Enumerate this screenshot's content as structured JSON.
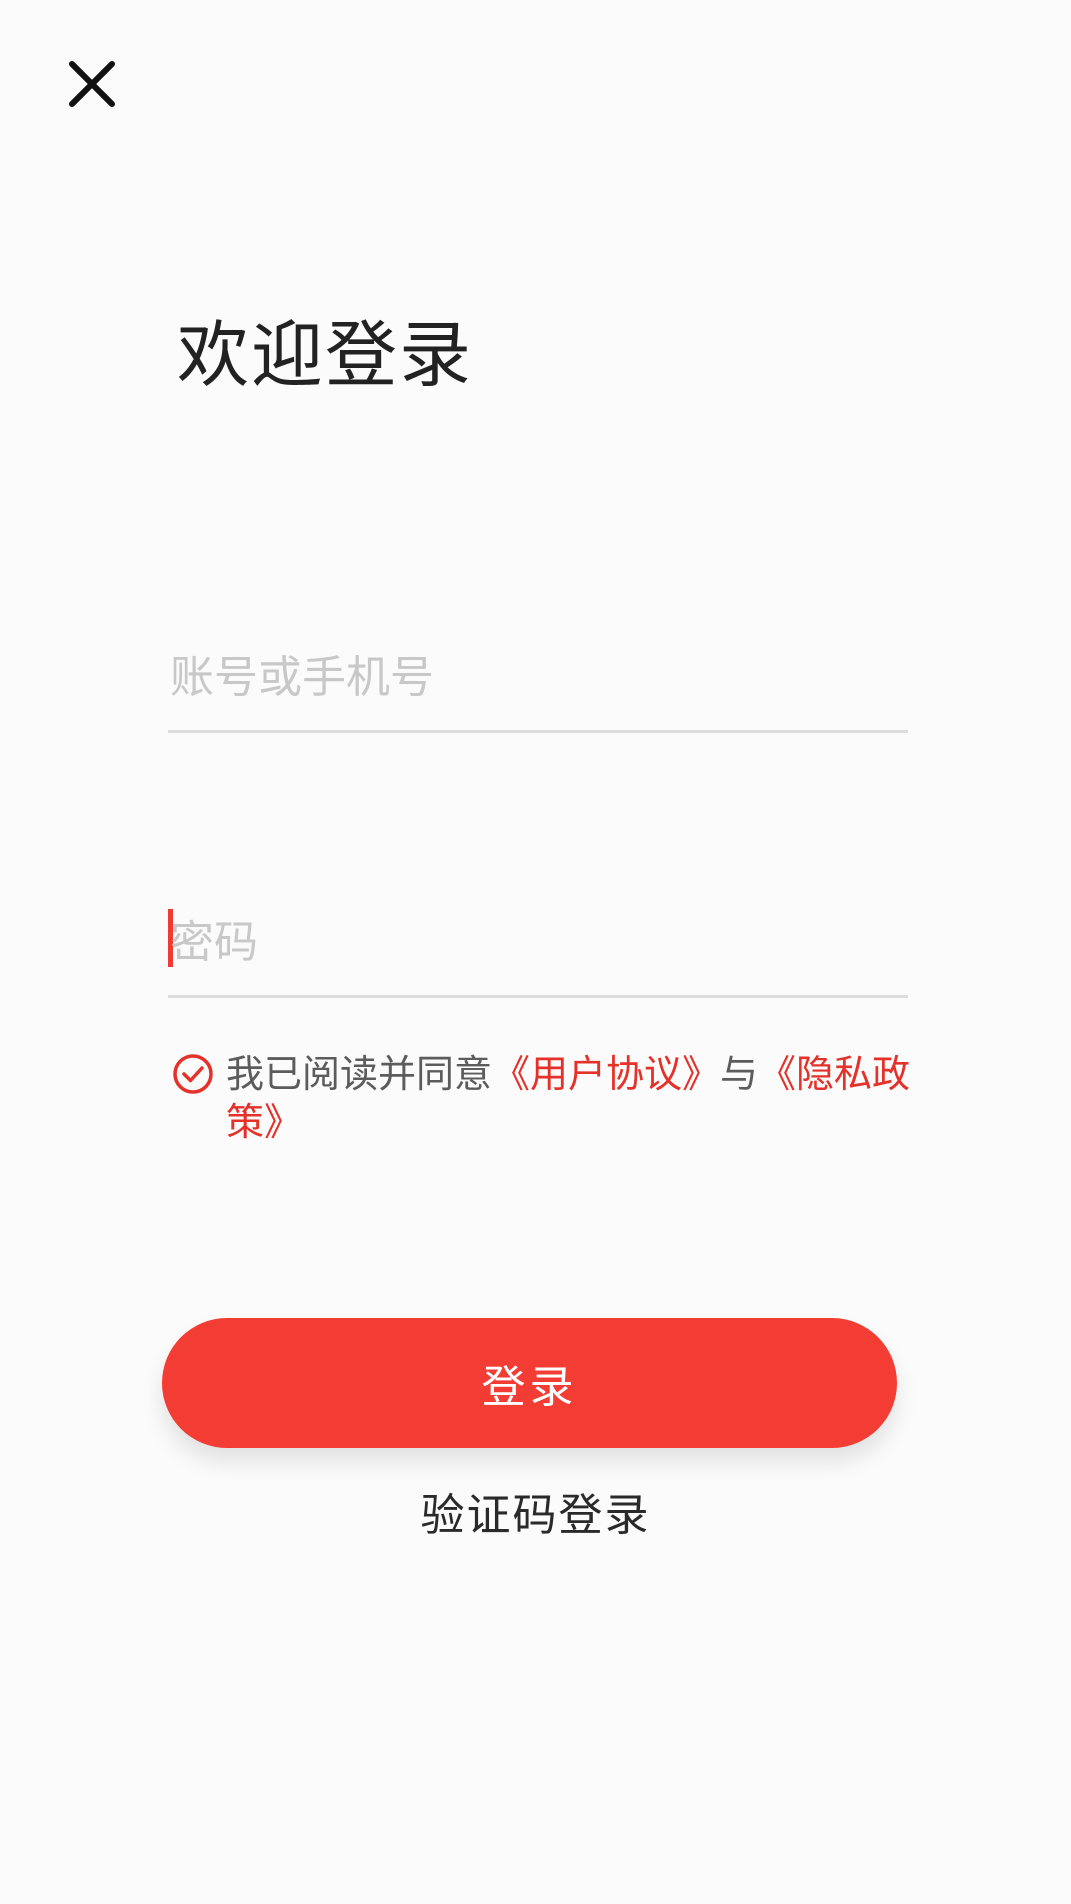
{
  "header": {
    "close_icon": "close-icon"
  },
  "title": "欢迎登录",
  "form": {
    "account_placeholder": "账号或手机号",
    "account_value": "",
    "password_placeholder": "密码",
    "password_value": ""
  },
  "agreement": {
    "checked": true,
    "check_icon": "check-circle-icon",
    "prefix": "我已阅读并同意",
    "user_agreement": "《用户协议》",
    "connector": "与",
    "privacy_policy": "《隐私政策》"
  },
  "actions": {
    "login_label": "登录",
    "code_login_label": "验证码登录"
  },
  "colors": {
    "accent": "#f33c34",
    "link": "#e4322a",
    "background": "#fbfbfb"
  }
}
